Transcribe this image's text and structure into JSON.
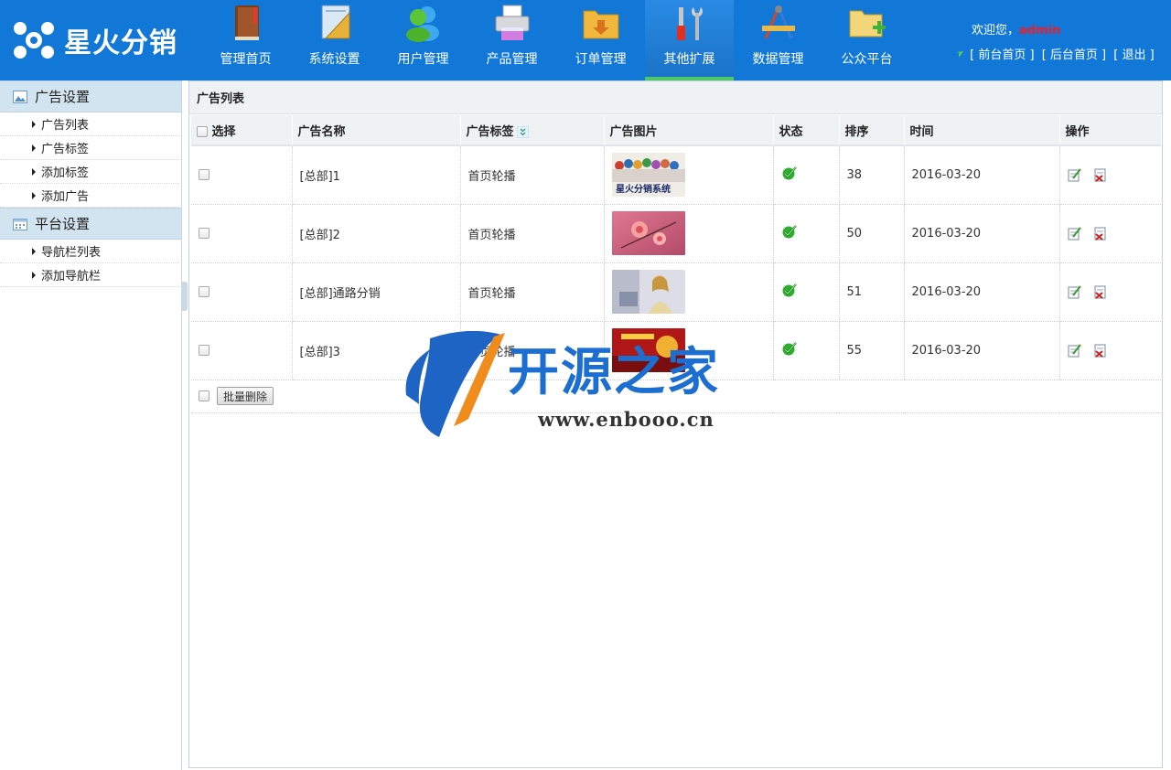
{
  "app": {
    "logo_text": "星火分销"
  },
  "nav": [
    {
      "label": "管理首页",
      "icon": "book-icon"
    },
    {
      "label": "系统设置",
      "icon": "ruler-icon"
    },
    {
      "label": "用户管理",
      "icon": "users-icon"
    },
    {
      "label": "产品管理",
      "icon": "printer-icon"
    },
    {
      "label": "订单管理",
      "icon": "folder-download-icon"
    },
    {
      "label": "其他扩展",
      "icon": "tools-icon",
      "active": true
    },
    {
      "label": "数据管理",
      "icon": "drafting-icon"
    },
    {
      "label": "公众平台",
      "icon": "folder-add-icon"
    }
  ],
  "user": {
    "welcome": "欢迎您，",
    "name": "admin",
    "links": [
      "[ 前台首页 ]",
      "[ 后台首页 ]",
      "[ 退出 ]"
    ]
  },
  "sidebar": {
    "groups": [
      {
        "title": "广告设置",
        "icon": "image-icon",
        "items": [
          "广告列表",
          "广告标签",
          "添加标签",
          "添加广告"
        ]
      },
      {
        "title": "平台设置",
        "icon": "calendar-icon",
        "items": [
          "导航栏列表",
          "添加导航栏"
        ]
      }
    ]
  },
  "main": {
    "title": "广告列表",
    "columns": [
      "选择",
      "广告名称",
      "广告标签",
      "广告图片",
      "状态",
      "排序",
      "时间",
      "操作"
    ],
    "rows": [
      {
        "name": "[总部]1",
        "tag": "首页轮播",
        "order": "38",
        "time": "2016-03-20",
        "thumb_text": "星火分销系统"
      },
      {
        "name": "[总部]2",
        "tag": "首页轮播",
        "order": "50",
        "time": "2016-03-20",
        "thumb_text": ""
      },
      {
        "name": "[总部]通路分销",
        "tag": "首页轮播",
        "order": "51",
        "time": "2016-03-20",
        "thumb_text": ""
      },
      {
        "name": "[总部]3",
        "tag": "首页轮播",
        "order": "55",
        "time": "2016-03-20",
        "thumb_text": ""
      }
    ],
    "batch_delete": "批量删除"
  },
  "watermark": {
    "title": "开源之家",
    "url": "www.enbooo.cn"
  }
}
